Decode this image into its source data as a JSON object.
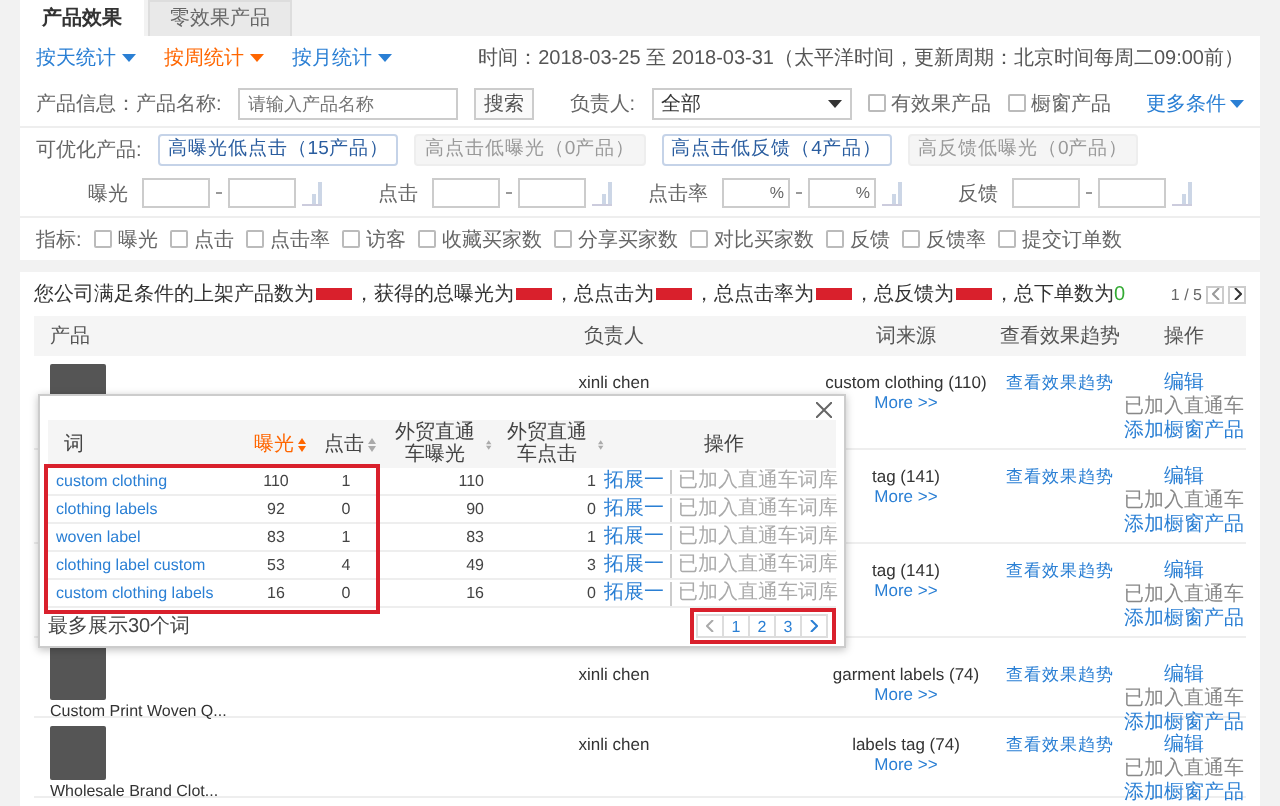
{
  "tabs": [
    {
      "label": "产品效果",
      "selected": true
    },
    {
      "label": "零效果产品",
      "selected": false
    }
  ],
  "periods": [
    {
      "label": "按天统计",
      "selected": false
    },
    {
      "label": "按周统计",
      "selected": true
    },
    {
      "label": "按月统计",
      "selected": false
    }
  ],
  "time_range": "时间：2018-03-25 至 2018-03-31（太平洋时间，更新周期：北京时间每周二09:00前）",
  "filters": {
    "product_label": "产品信息：产品名称:",
    "product_search": {
      "placeholder": "请输入产品名称"
    },
    "search_button": "搜索",
    "owner_label": "负责人:",
    "owner_select": "全部",
    "checkboxes": [
      {
        "label": "有效果产品",
        "checked": false
      },
      {
        "label": "橱窗产品",
        "checked": false
      }
    ],
    "more_link": "更多条件"
  },
  "optimizable": {
    "label": "可优化产品:",
    "options": [
      {
        "label": "高曝光低点击（15产品）",
        "disabled": false
      },
      {
        "label": "高点击低曝光（0产品）",
        "disabled": true
      },
      {
        "label": "高点击低反馈（4产品）",
        "disabled": false
      },
      {
        "label": "高反馈低曝光（0产品）",
        "disabled": true
      }
    ]
  },
  "ranges": [
    {
      "label": "曝光"
    },
    {
      "label": "点击"
    },
    {
      "label": "点击率",
      "unit": "%"
    },
    {
      "label": "反馈"
    }
  ],
  "indicators": {
    "label": "指标:",
    "items": [
      {
        "label": "曝光",
        "checked": false
      },
      {
        "label": "点击",
        "checked": false
      },
      {
        "label": "点击率",
        "checked": false
      },
      {
        "label": "访客",
        "checked": false
      },
      {
        "label": "收藏买家数",
        "checked": false
      },
      {
        "label": "分享买家数",
        "checked": false
      },
      {
        "label": "对比买家数",
        "checked": false
      },
      {
        "label": "反馈",
        "checked": false
      },
      {
        "label": "反馈率",
        "checked": false
      },
      {
        "label": "提交订单数",
        "checked": false
      }
    ]
  },
  "summary": [
    {
      "kind": "text",
      "text": "您公司满足条件的上架产品数为"
    },
    {
      "kind": "redacted"
    },
    {
      "kind": "text",
      "text": "，获得的总曝光为"
    },
    {
      "kind": "redacted"
    },
    {
      "kind": "text",
      "text": "，总点击为"
    },
    {
      "kind": "redacted"
    },
    {
      "kind": "text",
      "text": "，总点击率为"
    },
    {
      "kind": "redacted"
    },
    {
      "kind": "text",
      "text": "，总反馈为"
    },
    {
      "kind": "redacted"
    },
    {
      "kind": "text",
      "text": "，总下单数为"
    },
    {
      "kind": "value",
      "text": "0"
    }
  ],
  "pager": "1 / 5",
  "table": {
    "columns": [
      "产品",
      "负责人",
      "词来源",
      "查看效果趋势",
      "操作"
    ],
    "rows": [
      {
        "owner": "xinli chen",
        "term": "custom clothing (110)",
        "more": "More >>",
        "trend": "查看效果趋势",
        "actions": [
          {
            "kind": "link",
            "text": "编辑"
          },
          {
            "kind": "status",
            "text": "已加入直通车"
          },
          {
            "kind": "link",
            "text": "添加橱窗产品"
          }
        ]
      },
      {
        "term": "tag (141)",
        "more": "More >>",
        "trend": "查看效果趋势",
        "actions": [
          {
            "kind": "link",
            "text": "编辑"
          },
          {
            "kind": "status",
            "text": "已加入直通车"
          },
          {
            "kind": "link",
            "text": "添加橱窗产品"
          }
        ]
      },
      {
        "term": "tag (141)",
        "more": "More >>",
        "trend": "查看效果趋势",
        "actions": [
          {
            "kind": "link",
            "text": "编辑"
          },
          {
            "kind": "status",
            "text": "已加入直通车"
          },
          {
            "kind": "link",
            "text": "添加橱窗产品"
          }
        ]
      },
      {
        "product": "Custom Print Woven Q...",
        "owner": "xinli chen",
        "term": "garment labels (74)",
        "more": "More >>",
        "trend": "查看效果趋势",
        "actions": [
          {
            "kind": "link",
            "text": "编辑"
          },
          {
            "kind": "status",
            "text": "已加入直通车"
          },
          {
            "kind": "link",
            "text": "添加橱窗产品"
          }
        ]
      },
      {
        "product": "Wholesale Brand Clot...",
        "owner": "xinli chen",
        "term": "labels tag (74)",
        "more": "More >>",
        "trend": "查看效果趋势",
        "actions": [
          {
            "kind": "link",
            "text": "编辑"
          },
          {
            "kind": "status",
            "text": "已加入直通车"
          },
          {
            "kind": "link",
            "text": "添加橱窗产品"
          }
        ]
      }
    ]
  },
  "popup": {
    "columns": [
      {
        "label": "词",
        "sortable": false,
        "sorted": false
      },
      {
        "label": "曝光",
        "sortable": true,
        "sorted": true
      },
      {
        "label": "点击",
        "sortable": true,
        "sorted": false
      },
      {
        "label": "外贸直通车曝光",
        "sortable": true,
        "sorted": false
      },
      {
        "label": "外贸直通车点击",
        "sortable": true,
        "sorted": false
      },
      {
        "label": "操作",
        "sortable": false,
        "sorted": false
      }
    ],
    "rows": [
      {
        "word": "custom clothing",
        "exposure": "110",
        "clicks": "1",
        "p4p_exposure": "110",
        "p4p_clicks": "1",
        "action": "拓展一",
        "note": "已加入直通车词库"
      },
      {
        "word": "clothing labels",
        "exposure": "92",
        "clicks": "0",
        "p4p_exposure": "90",
        "p4p_clicks": "0",
        "action": "拓展一",
        "note": "已加入直通车词库"
      },
      {
        "word": "woven label",
        "exposure": "83",
        "clicks": "1",
        "p4p_exposure": "83",
        "p4p_clicks": "1",
        "action": "拓展一",
        "note": "已加入直通车词库"
      },
      {
        "word": "clothing label custom",
        "exposure": "53",
        "clicks": "4",
        "p4p_exposure": "49",
        "p4p_clicks": "3",
        "action": "拓展一",
        "note": "已加入直通车词库"
      },
      {
        "word": "custom clothing labels",
        "exposure": "16",
        "clicks": "0",
        "p4p_exposure": "16",
        "p4p_clicks": "0",
        "action": "拓展一",
        "note": "已加入直通车词库"
      }
    ],
    "footer": "最多展示30个词",
    "pages": [
      "1",
      "2",
      "3"
    ],
    "highlight_rows": true,
    "highlight_pager": true
  }
}
